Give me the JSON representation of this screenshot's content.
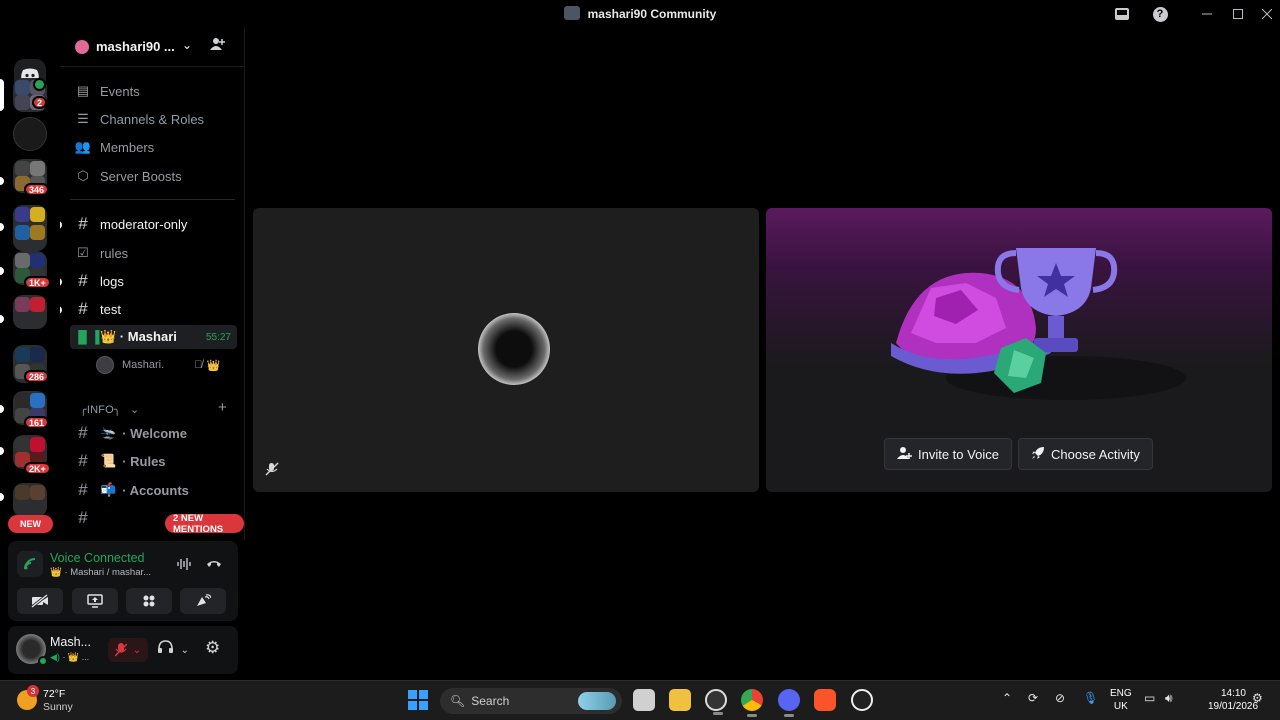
{
  "window": {
    "title": "mashari90 Community"
  },
  "rail": {
    "badges": [
      "2",
      "346",
      "1K+",
      "286",
      "161",
      "2K+"
    ],
    "new_label": "NEW"
  },
  "server": {
    "name": "mashari90 ..."
  },
  "nav": [
    {
      "label": "Events",
      "icon": "calendar-icon"
    },
    {
      "label": "Channels & Roles",
      "icon": "list-icon"
    },
    {
      "label": "Members",
      "icon": "members-icon"
    },
    {
      "label": "Server Boosts",
      "icon": "boost-icon"
    }
  ],
  "channels": [
    {
      "label": "moderator-only",
      "unread": true
    },
    {
      "label": "rules",
      "unread": false
    },
    {
      "label": "logs",
      "unread": true
    },
    {
      "label": "test",
      "unread": true
    }
  ],
  "voice_channel": {
    "label": "👑 · Mashari",
    "time": "55:27",
    "user": "Mashari."
  },
  "category": {
    "label": "╭INFO╮"
  },
  "info_channels": [
    {
      "label": "· Welcome",
      "emoji": "🛬"
    },
    {
      "label": "· Rules",
      "emoji": "📜"
    },
    {
      "label": "· Accounts",
      "emoji": "📬"
    }
  ],
  "mentions": {
    "label": "2 NEW MENTIONS"
  },
  "voice_panel": {
    "status": "Voice Connected",
    "channel": "👑 · Mashari / mashar..."
  },
  "user_panel": {
    "name": "Mash...",
    "sub": "· 👑 ..."
  },
  "stage": {
    "invite_label": "Invite to Voice",
    "activity_label": "Choose Activity"
  },
  "taskbar": {
    "weather_temp": "72°F",
    "weather_desc": "Sunny",
    "weather_badge": "3",
    "search_label": "Search",
    "lang_top": "ENG",
    "lang_bottom": "UK",
    "time": "14:10",
    "date": "19/01/2026"
  },
  "colors": {
    "accent_green": "#23a55a",
    "mention_red": "#da373c",
    "windows_blue": "#3aa0ff"
  }
}
